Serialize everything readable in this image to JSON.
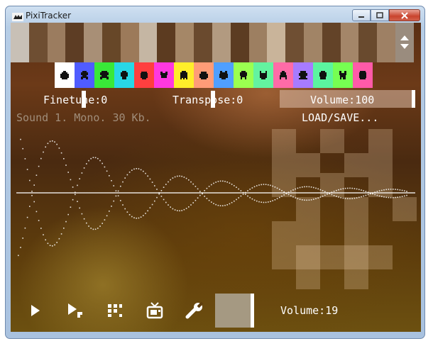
{
  "window": {
    "title": "PixiTracker"
  },
  "controls": {
    "minimize": "minimize",
    "maximize": "maximize",
    "close": "close"
  },
  "piano": {
    "keys": [
      {
        "color": "#c8c0b6"
      },
      {
        "color": "#6e4e32"
      },
      {
        "color": "#9b7c5f"
      },
      {
        "color": "#5d3d24"
      },
      {
        "color": "#a88f76"
      },
      {
        "color": "#674728"
      },
      {
        "color": "#9c7a5a"
      },
      {
        "color": "#c5b6a3"
      },
      {
        "color": "#5c3b20"
      },
      {
        "color": "#a58767"
      },
      {
        "color": "#6a4a2e"
      },
      {
        "color": "#b29a80"
      },
      {
        "color": "#5c3c22"
      },
      {
        "color": "#9d7f61"
      },
      {
        "color": "#c9b49a"
      },
      {
        "color": "#6f4f33"
      },
      {
        "color": "#a18466"
      },
      {
        "color": "#634328"
      },
      {
        "color": "#a48669"
      },
      {
        "color": "#694a2e"
      },
      {
        "color": "#9e8064"
      }
    ]
  },
  "patches": [
    {
      "icon": "bug-icon",
      "bg": "#ffffff"
    },
    {
      "icon": "alien-icon",
      "bg": "#4f5cff"
    },
    {
      "icon": "invader-icon",
      "bg": "#39e838"
    },
    {
      "icon": "skull-icon",
      "bg": "#28d7e6"
    },
    {
      "icon": "robot-icon",
      "bg": "#ff3f3f"
    },
    {
      "icon": "crab-icon",
      "bg": "#ff38e0"
    },
    {
      "icon": "ghost-icon",
      "bg": "#ffee2a"
    },
    {
      "icon": "tank-icon",
      "bg": "#ff9c77"
    },
    {
      "icon": "frog-icon",
      "bg": "#4f9fff"
    },
    {
      "icon": "octopus-icon",
      "bg": "#9bff50"
    },
    {
      "icon": "cat-icon",
      "bg": "#63f3a0"
    },
    {
      "icon": "squid-icon",
      "bg": "#ff6ba7"
    },
    {
      "icon": "spider-icon",
      "bg": "#a77bff"
    },
    {
      "icon": "beetle-icon",
      "bg": "#5bf49f"
    },
    {
      "icon": "dog-icon",
      "bg": "#76ff52"
    },
    {
      "icon": "face-icon",
      "bg": "#ff5aa8"
    }
  ],
  "params": {
    "finetune": "Finetune:0",
    "transpose": "Transpose:0",
    "volume": "Volume:100"
  },
  "sample": {
    "info": "Sound 1. Mono. 30 Kb.",
    "load_save": "LOAD/SAVE..."
  },
  "toolbar": {
    "play": "play-icon",
    "play_pattern": "play-pattern-icon",
    "pattern": "grid-icon",
    "tv": "tv-icon",
    "settings": "wrench-icon",
    "volume": "Volume:19"
  }
}
